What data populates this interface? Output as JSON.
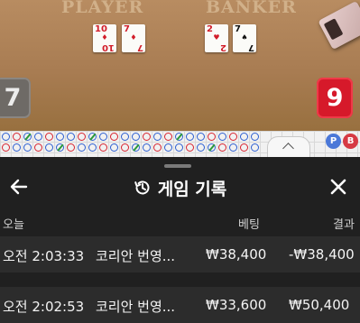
{
  "table": {
    "player_label": "PLAYER",
    "banker_label": "BANKER",
    "player_score": "7",
    "banker_score": "9",
    "player_cards": [
      {
        "rank": "10",
        "suit": "♦",
        "color": "red"
      },
      {
        "rank": "7",
        "suit": "♦",
        "color": "red"
      }
    ],
    "banker_cards": [
      {
        "rank": "2",
        "suit": "♥",
        "color": "red"
      },
      {
        "rank": "7",
        "suit": "♠",
        "color": "black"
      }
    ]
  },
  "roadmap": {
    "player_button": "P",
    "banker_button": "B"
  },
  "history": {
    "title": "게임 기록",
    "icons": {
      "back": "arrow-left-icon",
      "history": "history-clock-icon",
      "close": "close-icon"
    },
    "columns": {
      "date": "오늘",
      "bet": "베팅",
      "result": "결과"
    },
    "rows": [
      {
        "time": "오전 2:03:33",
        "game": "코리안 번영...",
        "bet": "₩38,400",
        "result": "-₩38,400"
      },
      {
        "time": "오전 2:02:53",
        "game": "코리안 번영...",
        "bet": "₩33,600",
        "result": "₩50,400"
      }
    ]
  },
  "colors": {
    "felt": "#a87c52",
    "player_blue": "#2d5fd1",
    "banker_red": "#d8232f",
    "sheet_bg": "#202020"
  }
}
